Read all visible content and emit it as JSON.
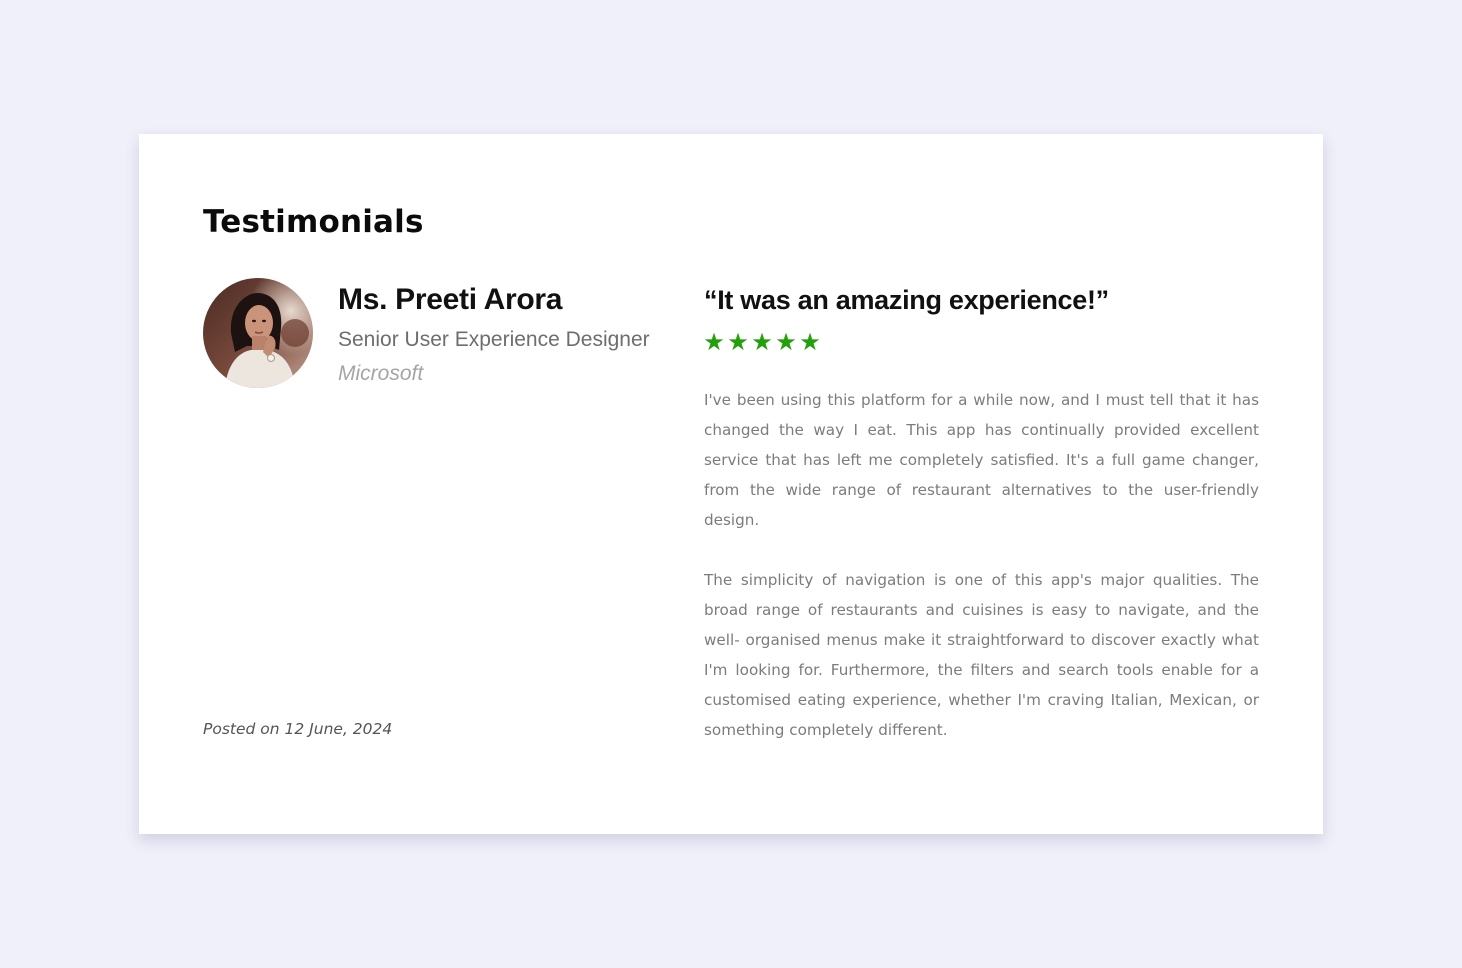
{
  "section": {
    "title": "Testimonials"
  },
  "testimonial": {
    "author": {
      "name": "Ms. Preeti Arora",
      "role": "Senior User Experience Designer",
      "company": "Microsoft",
      "avatar_icon": "profile-photo"
    },
    "posted_date": "Posted on 12 June, 2024",
    "quote_title": "“It was an amazing experience!”",
    "rating": {
      "value": 5,
      "max": 5,
      "star_glyphs": [
        "★",
        "★",
        "★",
        "★",
        "★"
      ],
      "color": "#22a00a"
    },
    "review_paragraphs": [
      "I've been using this platform for a while now, and I must tell that it has changed the way I eat. This app has continually provided excellent service that has left me completely satisfied. It's a full game changer, from the wide range of restaurant alternatives to the user-friendly design.",
      "The simplicity of navigation is one of this app's major qualities. The broad range of restaurants and cuisines is easy to navigate, and the well- organised menus make it straightforward to discover exactly what I'm looking for. Furthermore, the filters and search tools enable for a customised eating experience, whether I'm craving Italian, Mexican, or something completely different."
    ]
  },
  "colors": {
    "page_background": "#f0f0fa",
    "card_background": "#ffffff",
    "star_accent": "#22a00a"
  }
}
